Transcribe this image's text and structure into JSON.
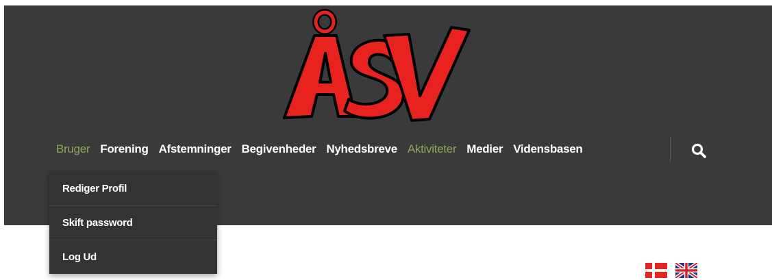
{
  "header": {
    "background": "#3a3a3a",
    "logo_text": "ÅSV",
    "logo_colors": {
      "fill": "#e8231f",
      "outline": "#000000"
    }
  },
  "nav": {
    "items": [
      {
        "label": "Bruger",
        "active": true
      },
      {
        "label": "Forening",
        "active": false
      },
      {
        "label": "Afstemninger",
        "active": false
      },
      {
        "label": "Begivenheder",
        "active": false
      },
      {
        "label": "Nyhedsbreve",
        "active": false
      },
      {
        "label": "Aktiviteter",
        "active": true
      },
      {
        "label": "Medier",
        "active": false
      },
      {
        "label": "Vidensbasen",
        "active": false
      }
    ],
    "active_color": "#8fa55a",
    "search_icon": "search-icon"
  },
  "dropdown": {
    "items": [
      {
        "label": "Rediger Profil"
      },
      {
        "label": "Skift password"
      },
      {
        "label": "Log Ud"
      }
    ]
  },
  "languages": [
    {
      "icon": "danish-flag-icon"
    },
    {
      "icon": "uk-flag-icon"
    }
  ]
}
